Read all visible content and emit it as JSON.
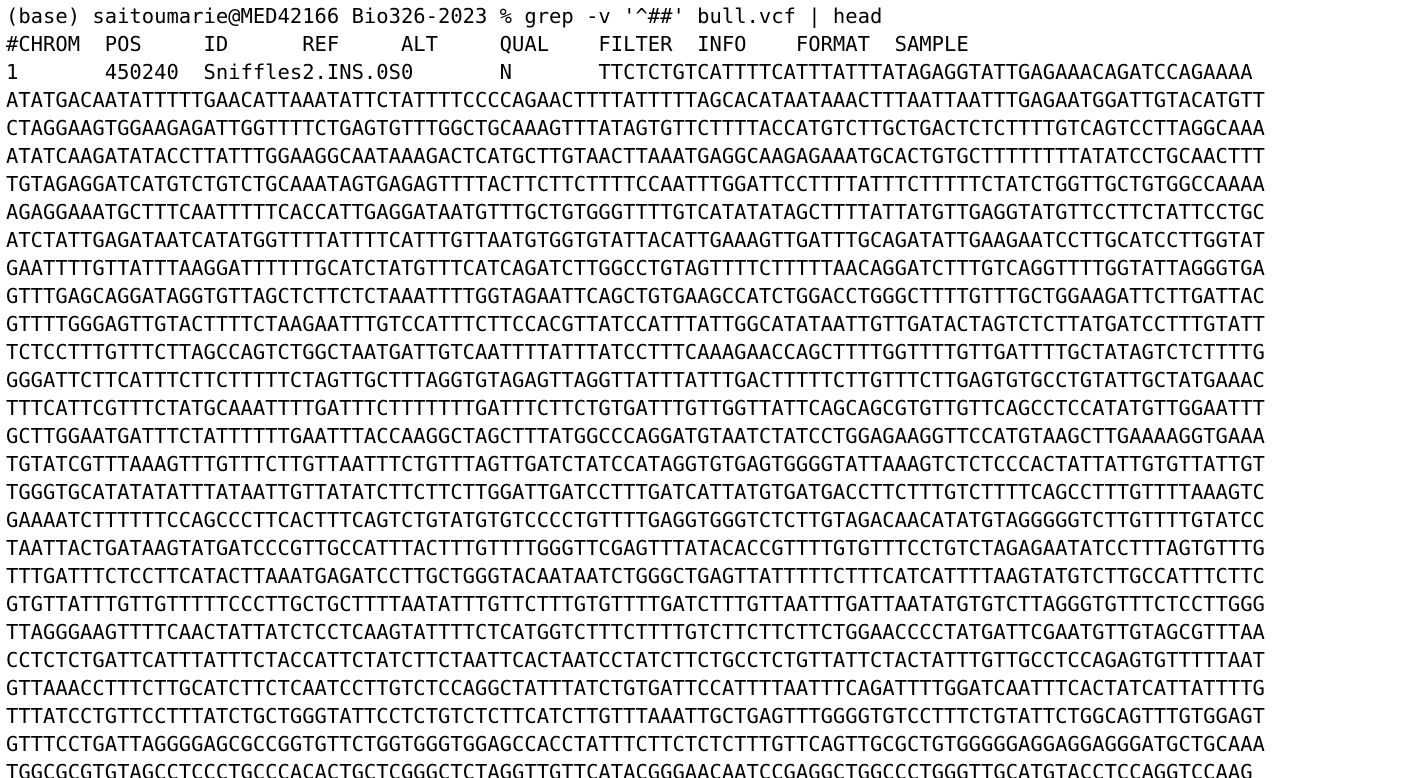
{
  "terminal": {
    "prompt": "(base) saitoumarie@MED42166 Bio326-2023 % ",
    "command": "grep -v '^##' bull.vcf | head",
    "header": "#CHROM  POS     ID      REF     ALT     QUAL    FILTER  INFO    FORMAT  SAMPLE",
    "record_start": "1       450240  Sniffles2.INS.0S0       N       TTCTCTGTCATTTTCATTTATTTATAGAGGTATTGAGAAACAGATCCAGAAAA",
    "sequence_lines": [
      "ATATGACAATATTTTTGAACATTAAATATTCTATTTTCCCCAGAACTTTTATTTTTAGCACATAATAAACTTTAATTAATTTGAGAATGGATTGTACATGTT",
      "CTAGGAAGTGGAAGAGATTGGTTTTCTGAGTGTTTGGCTGCAAAGTTTATAGTGTTCTTTTACCATGTCTTGCTGACTCTCTTTTGTCAGTCCTTAGGCAAA",
      "ATATCAAGATATACCTTATTTGGAAGGCAATAAAGACTCATGCTTGTAACTTAAATGAGGCAAGAGAAATGCACTGTGCTTTTTTTTATATCCTGCAACTTT",
      "TGTAGAGGATCATGTCTGTCTGCAAATAGTGAGAGTTTTACTTCTTCTTTTCCAATTTGGATTCCTTTTATTTCTTTTTCTATCTGGTTGCTGTGGCCAAAA",
      "AGAGGAAATGCTTTCAATTTTTCACCATTGAGGATAATGTTTGCTGTGGGTTTTGTCATATATAGCTTTTATTATGTTGAGGTATGTTCCTTCTATTCCTGC",
      "ATCTATTGAGATAATCATATGGTTTTATTTTCATTTGTTAATGTGGTGTATTACATTGAAAGTTGATTTGCAGATATTGAAGAATCCTTGCATCCTTGGTAT",
      "GAATTTTGTTATTTAAGGATTTTTTGCATCTATGTTTCATCAGATCTTGGCCTGTAGTTTTCTTTTTAACAGGATCTTTGTCAGGTTTTGGTATTAGGGTGA",
      "GTTTGAGCAGGATAGGTGTTAGCTCTTCTCTAAATTTTGGTAGAATTCAGCTGTGAAGCCATCTGGACCTGGGCTTTTGTTTGCTGGAAGATTCTTGATTAC",
      "GTTTTGGGAGTTGTACTTTTCTAAGAATTTGTCCATTTCTTCCACGTTATCCATTTATTGGCATATAATTGTTGATACTAGTCTCTTATGATCCTTTGTATT",
      "TCTCCTTTGTTTCTTAGCCAGTCTGGCTAATGATTGTCAATTTTATTTATCCTTTCAAAGAACCAGCTTTTGGTTTTGTTGATTTTGCTATAGTCTCTTTTG",
      "GGGATTCTTCATTTCTTCTTTTTCTAGTTGCTTTAGGTGTAGAGTTAGGTTATTTATTTGACTTTTTCTTGTTTCTTGAGTGTGCCTGTATTGCTATGAAAC",
      "TTTCATTCGTTTCTATGCAAATTTTGATTTCTTTTTTTGATTTCTTCTGTGATTTGTTGGTTATTCAGCAGCGTGTTGTTCAGCCTCCATATGTTGGAATTT",
      "GCTTGGAATGATTTCTATTTTTTGAATTTACCAAGGCTAGCTTTATGGCCCAGGATGTAATCTATCCTGGAGAAGGTTCCATGTAAGCTTGAAAAGGTGAAA",
      "TGTATCGTTTAAAGTTTGTTTCTTGTTAATTTCTGTTTAGTTGATCTATCCATAGGTGTGAGTGGGGTATTAAAGTCTCTCCCACTATTATTGTGTTATTGT",
      "TGGGTGCATATATATTTATAATTGTTATATCTTCTTCTTGGATTGATCCTTTGATCATTATGTGATGACCTTCTTTGTCTTTTCAGCCTTTGTTTTAAAGTC",
      "GAAAATCTTTTTTCCAGCCCTTCACTTTCAGTCTGTATGTGTCCCCTGTTTTGAGGTGGGTCTCTTGTAGACAACATATGTAGGGGGTCTTGTTTTGTATCC",
      "TAATTACTGATAAGTATGATCCCGTTGCCATTTACTTTGTTTTGGGTTCGAGTTTATACACCGTTTTGTGTTTCCTGTCTAGAGAATATCCTTTAGTGTTTG",
      "TTTGATTTCTCCTTCATACTTAAATGAGATCCTTGCTGGGTACAATAATCTGGGCTGAGTTATTTTTCTTTCATCATTTTAAGTATGTCTTGCCATTTCTTC",
      "GTGTTATTTGTTGTTTTTCCCTTGCTGCTTTTAATATTTGTTCTTTGTGTTTTGATCTTTGTTAATTTGATTAATATGTGTCTTAGGGTGTTTCTCCTTGGG",
      "TTAGGGAAGTTTTCAACTATTATCTCCTCAAGTATTTTCTCATGGTCTTTCTTTTGTCTTCTTCTTCTGGAACCCCTATGATTCGAATGTTGTAGCGTTTAA",
      "CCTCTCTGATTCATTTATTTCTACCATTCTATCTTCTAATTCACTAATCCTATCTTCTGCCTCTGTTATTCTACTATTTGTTGCCTCCAGAGTGTTTTTAAT",
      "GTTAAACCTTTCTTGCATCTTCTCAATCCTTGTCTCCAGGCTATTTATCTGTGATTCCATTTTAATTTCAGATTTTGGATCAATTTCACTATCATTATTTTG",
      "TTTATCCTGTTCCTTTATCTGCTGGGTATTCCTCTGTCTCTTCATCTTGTTTAAATTGCTGAGTTTGGGGTGTCCTTTCTGTATTCTGGCAGTTTGTGGAGT",
      "GTTTCCTGATTAGGGGAGCGCCGGTGTTCTGGTGGGTGGAGCCACCTATTTCTTCTCTCTTTGTTCAGTTGCGCTGTGGGGGAGGAGGAGGGATGCTGCAAA",
      "TGGCGCGTGTAGCCTCCCTGCCCACACTGCTCGGGCTCTAGGTTGTTCATACGGGAACAATCCGAGGCTGGCCCTGGGTTGCATGTACCTCCAGGTCCAAG"
    ]
  }
}
